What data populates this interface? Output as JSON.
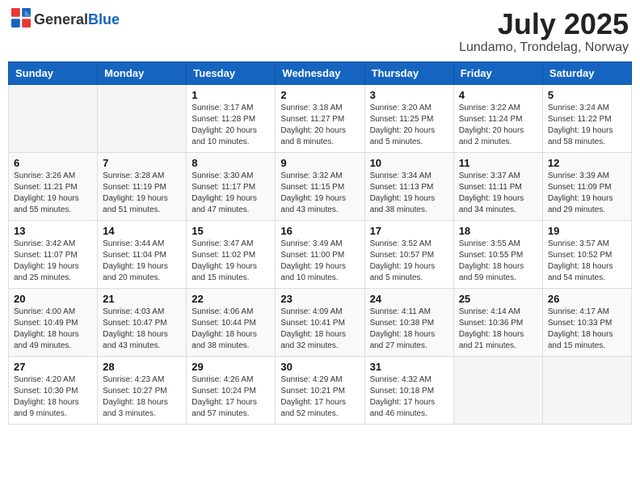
{
  "header": {
    "logo_general": "General",
    "logo_blue": "Blue",
    "month_title": "July 2025",
    "location": "Lundamo, Trondelag, Norway"
  },
  "days_of_week": [
    "Sunday",
    "Monday",
    "Tuesday",
    "Wednesday",
    "Thursday",
    "Friday",
    "Saturday"
  ],
  "weeks": [
    [
      {
        "day": "",
        "info": ""
      },
      {
        "day": "",
        "info": ""
      },
      {
        "day": "1",
        "info": "Sunrise: 3:17 AM\nSunset: 11:28 PM\nDaylight: 20 hours\nand 10 minutes."
      },
      {
        "day": "2",
        "info": "Sunrise: 3:18 AM\nSunset: 11:27 PM\nDaylight: 20 hours\nand 8 minutes."
      },
      {
        "day": "3",
        "info": "Sunrise: 3:20 AM\nSunset: 11:25 PM\nDaylight: 20 hours\nand 5 minutes."
      },
      {
        "day": "4",
        "info": "Sunrise: 3:22 AM\nSunset: 11:24 PM\nDaylight: 20 hours\nand 2 minutes."
      },
      {
        "day": "5",
        "info": "Sunrise: 3:24 AM\nSunset: 11:22 PM\nDaylight: 19 hours\nand 58 minutes."
      }
    ],
    [
      {
        "day": "6",
        "info": "Sunrise: 3:26 AM\nSunset: 11:21 PM\nDaylight: 19 hours\nand 55 minutes."
      },
      {
        "day": "7",
        "info": "Sunrise: 3:28 AM\nSunset: 11:19 PM\nDaylight: 19 hours\nand 51 minutes."
      },
      {
        "day": "8",
        "info": "Sunrise: 3:30 AM\nSunset: 11:17 PM\nDaylight: 19 hours\nand 47 minutes."
      },
      {
        "day": "9",
        "info": "Sunrise: 3:32 AM\nSunset: 11:15 PM\nDaylight: 19 hours\nand 43 minutes."
      },
      {
        "day": "10",
        "info": "Sunrise: 3:34 AM\nSunset: 11:13 PM\nDaylight: 19 hours\nand 38 minutes."
      },
      {
        "day": "11",
        "info": "Sunrise: 3:37 AM\nSunset: 11:11 PM\nDaylight: 19 hours\nand 34 minutes."
      },
      {
        "day": "12",
        "info": "Sunrise: 3:39 AM\nSunset: 11:09 PM\nDaylight: 19 hours\nand 29 minutes."
      }
    ],
    [
      {
        "day": "13",
        "info": "Sunrise: 3:42 AM\nSunset: 11:07 PM\nDaylight: 19 hours\nand 25 minutes."
      },
      {
        "day": "14",
        "info": "Sunrise: 3:44 AM\nSunset: 11:04 PM\nDaylight: 19 hours\nand 20 minutes."
      },
      {
        "day": "15",
        "info": "Sunrise: 3:47 AM\nSunset: 11:02 PM\nDaylight: 19 hours\nand 15 minutes."
      },
      {
        "day": "16",
        "info": "Sunrise: 3:49 AM\nSunset: 11:00 PM\nDaylight: 19 hours\nand 10 minutes."
      },
      {
        "day": "17",
        "info": "Sunrise: 3:52 AM\nSunset: 10:57 PM\nDaylight: 19 hours\nand 5 minutes."
      },
      {
        "day": "18",
        "info": "Sunrise: 3:55 AM\nSunset: 10:55 PM\nDaylight: 18 hours\nand 59 minutes."
      },
      {
        "day": "19",
        "info": "Sunrise: 3:57 AM\nSunset: 10:52 PM\nDaylight: 18 hours\nand 54 minutes."
      }
    ],
    [
      {
        "day": "20",
        "info": "Sunrise: 4:00 AM\nSunset: 10:49 PM\nDaylight: 18 hours\nand 49 minutes."
      },
      {
        "day": "21",
        "info": "Sunrise: 4:03 AM\nSunset: 10:47 PM\nDaylight: 18 hours\nand 43 minutes."
      },
      {
        "day": "22",
        "info": "Sunrise: 4:06 AM\nSunset: 10:44 PM\nDaylight: 18 hours\nand 38 minutes."
      },
      {
        "day": "23",
        "info": "Sunrise: 4:09 AM\nSunset: 10:41 PM\nDaylight: 18 hours\nand 32 minutes."
      },
      {
        "day": "24",
        "info": "Sunrise: 4:11 AM\nSunset: 10:38 PM\nDaylight: 18 hours\nand 27 minutes."
      },
      {
        "day": "25",
        "info": "Sunrise: 4:14 AM\nSunset: 10:36 PM\nDaylight: 18 hours\nand 21 minutes."
      },
      {
        "day": "26",
        "info": "Sunrise: 4:17 AM\nSunset: 10:33 PM\nDaylight: 18 hours\nand 15 minutes."
      }
    ],
    [
      {
        "day": "27",
        "info": "Sunrise: 4:20 AM\nSunset: 10:30 PM\nDaylight: 18 hours\nand 9 minutes."
      },
      {
        "day": "28",
        "info": "Sunrise: 4:23 AM\nSunset: 10:27 PM\nDaylight: 18 hours\nand 3 minutes."
      },
      {
        "day": "29",
        "info": "Sunrise: 4:26 AM\nSunset: 10:24 PM\nDaylight: 17 hours\nand 57 minutes."
      },
      {
        "day": "30",
        "info": "Sunrise: 4:29 AM\nSunset: 10:21 PM\nDaylight: 17 hours\nand 52 minutes."
      },
      {
        "day": "31",
        "info": "Sunrise: 4:32 AM\nSunset: 10:18 PM\nDaylight: 17 hours\nand 46 minutes."
      },
      {
        "day": "",
        "info": ""
      },
      {
        "day": "",
        "info": ""
      }
    ]
  ]
}
